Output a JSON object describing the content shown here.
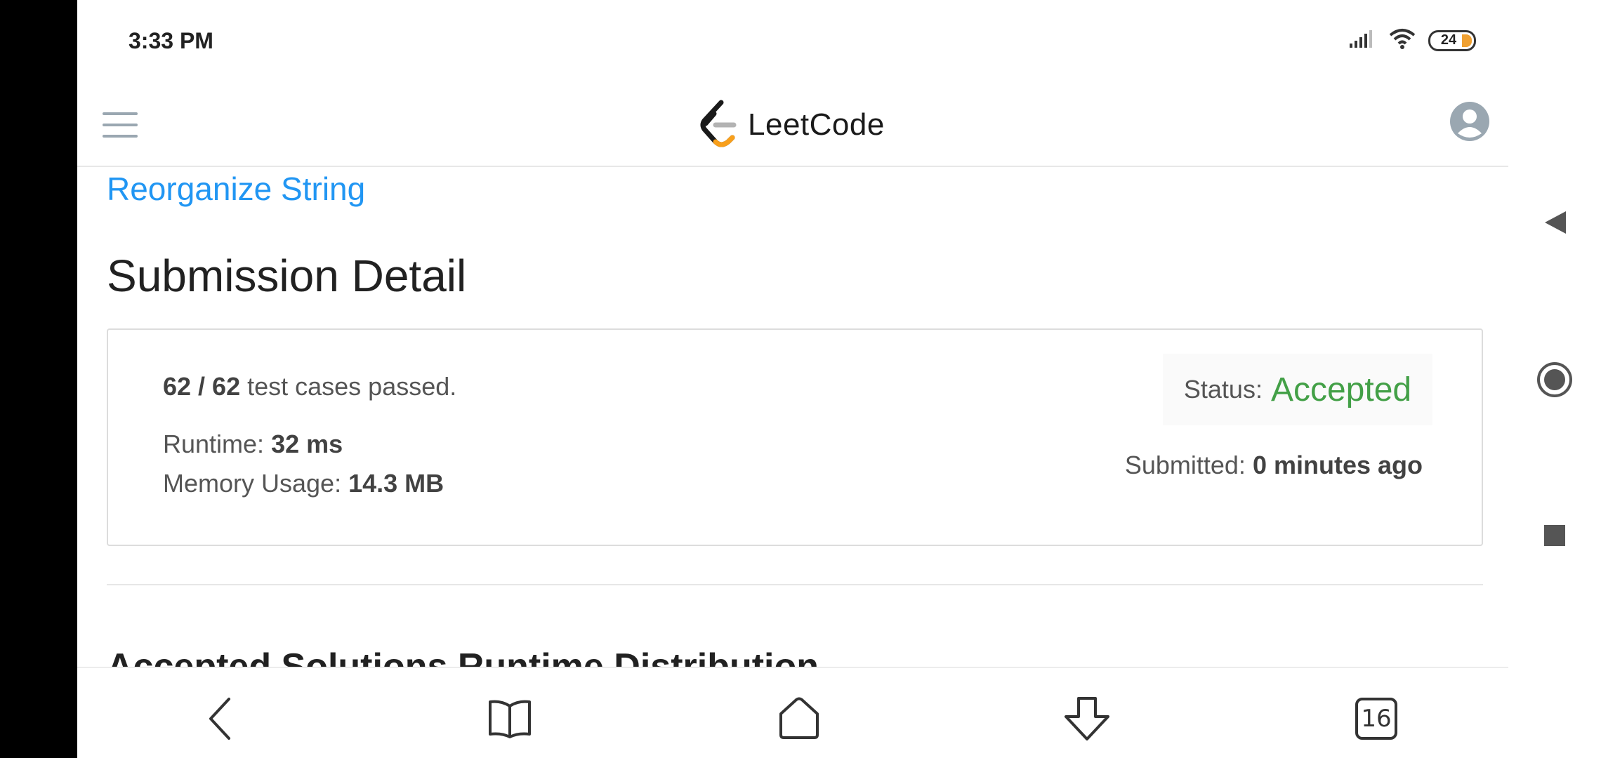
{
  "status_bar": {
    "time": "3:33 PM",
    "battery_level": "24"
  },
  "header": {
    "logo_text": "LeetCode"
  },
  "problem": {
    "title": "Reorganize String"
  },
  "page": {
    "title": "Submission Detail"
  },
  "submission": {
    "cases_passed": "62 / 62",
    "cases_suffix": " test cases passed.",
    "runtime_label": "Runtime: ",
    "runtime_value": "32 ms",
    "memory_label": "Memory Usage: ",
    "memory_value": "14.3 MB",
    "status_label": "Status:",
    "status_value": "Accepted",
    "submitted_label": "Submitted: ",
    "submitted_value": "0 minutes ago"
  },
  "sections": {
    "runtime_distribution_heading": "Accepted Solutions Runtime Distribution"
  },
  "toolbar": {
    "tabs_count": "16"
  },
  "colors": {
    "link": "#2196f3",
    "accepted": "#43a047",
    "logo_orange": "#f89f1b"
  }
}
